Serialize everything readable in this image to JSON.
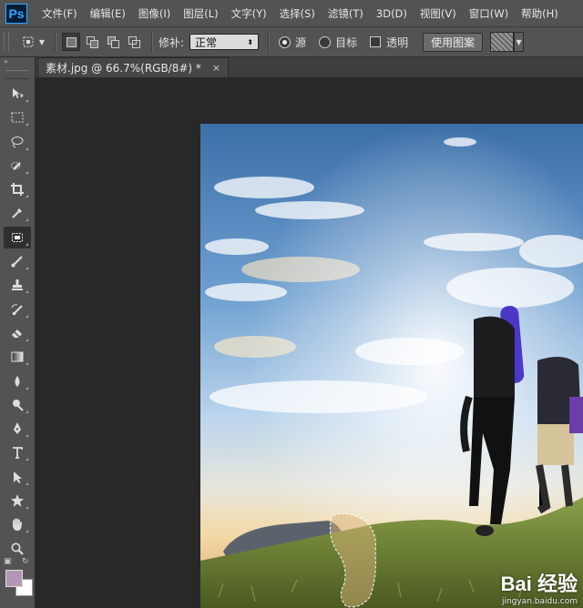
{
  "app": {
    "logo": "Ps"
  },
  "menu": [
    "文件(F)",
    "编辑(E)",
    "图像(I)",
    "图层(L)",
    "文字(Y)",
    "选择(S)",
    "滤镜(T)",
    "3D(D)",
    "视图(V)",
    "窗口(W)",
    "帮助(H)"
  ],
  "options": {
    "patch_label": "修补:",
    "patch_mode": "正常",
    "source_label": "源",
    "source_checked": true,
    "target_label": "目标",
    "transparent_label": "透明",
    "use_pattern_label": "使用图案"
  },
  "toolbar": {
    "collapse": "»",
    "tools": [
      "move-icon",
      "marquee-icon",
      "lasso-icon",
      "quick-selection-icon",
      "crop-icon",
      "eyedropper-icon",
      "patch-icon",
      "brush-icon",
      "stamp-icon",
      "history-brush-icon",
      "eraser-icon",
      "gradient-icon",
      "blur-icon",
      "dodge-icon",
      "pen-icon",
      "type-icon",
      "path-select-icon",
      "shape-icon",
      "hand-icon",
      "zoom-icon"
    ],
    "active_tool": "patch-icon",
    "foreground_color": "#b397b4",
    "background_color": "#ffffff"
  },
  "document": {
    "tab_title": "素材.jpg @ 66.7%(RGB/8#) *",
    "close": "×"
  },
  "watermark": {
    "logo": "Bai 经验",
    "url": "jingyan.baidu.com"
  }
}
